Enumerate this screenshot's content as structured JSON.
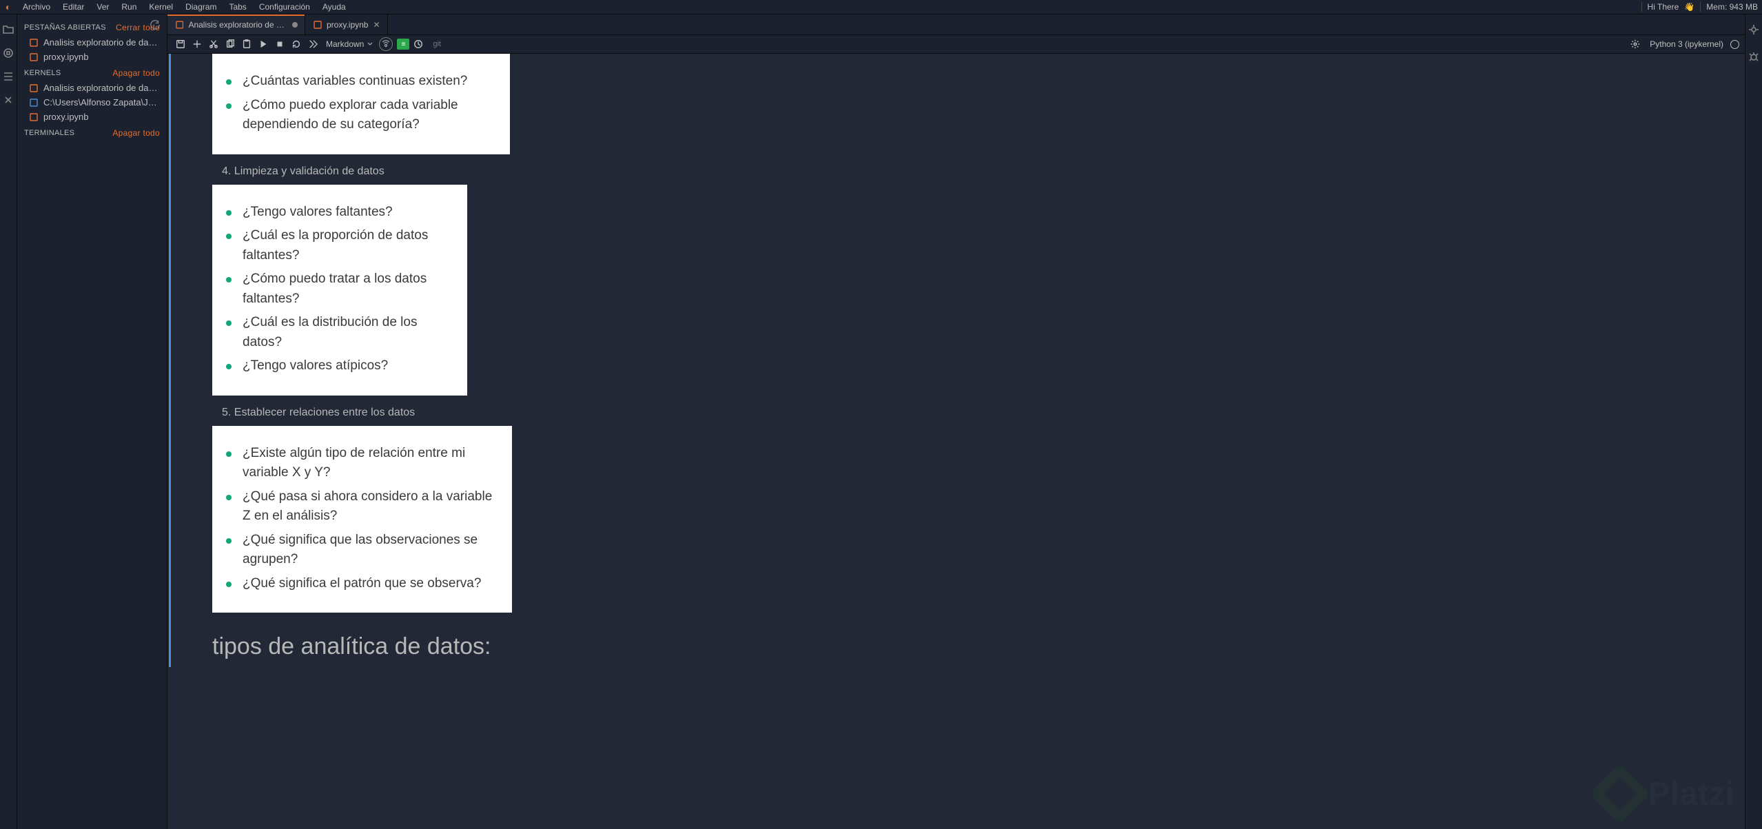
{
  "menubar": {
    "items": [
      "Archivo",
      "Editar",
      "Ver",
      "Run",
      "Kernel",
      "Diagram",
      "Tabs",
      "Configuración",
      "Ayuda"
    ],
    "hi": "Hi There",
    "mem": "Mem: 943 MB"
  },
  "sidebar": {
    "sections": [
      {
        "title": "Pestañas abiertas",
        "action": "Cerrar todo",
        "items": [
          {
            "label": "Analisis exploratorio de datos.i...",
            "icon": "nb"
          },
          {
            "label": "proxy.ipynb",
            "icon": "nb"
          }
        ]
      },
      {
        "title": "Kernels",
        "action": "Apagar todo",
        "items": [
          {
            "label": "Analisis exploratorio de datos.i...",
            "icon": "nb"
          },
          {
            "label": "C:\\Users\\Alfonso Zapata\\Jupyt...",
            "icon": "blue"
          },
          {
            "label": "proxy.ipynb",
            "icon": "nb"
          }
        ]
      },
      {
        "title": "Terminales",
        "action": "Apagar todo",
        "items": []
      }
    ]
  },
  "tabs": [
    {
      "label": "Analisis exploratorio de dato",
      "dirty": true,
      "active": true
    },
    {
      "label": "proxy.ipynb",
      "dirty": false,
      "active": false
    }
  ],
  "toolbar": {
    "celltype": "Markdown",
    "git": "git",
    "kernel": "Python 3 (ipykernel)"
  },
  "notebook": {
    "card1": {
      "items": [
        "¿Cuántas variables continuas existen?",
        "¿Cómo puedo explorar cada variable dependiendo de su categoría?"
      ]
    },
    "num4": "4. Limpieza y validación de datos",
    "card2": {
      "items": [
        "¿Tengo valores faltantes?",
        "¿Cuál es la proporción de datos faltantes?",
        "¿Cómo puedo tratar a los datos faltantes?",
        "¿Cuál es la distribución de los datos?",
        "¿Tengo valores atípicos?"
      ]
    },
    "num5": "5. Establecer relaciones entre los datos",
    "card3": {
      "items": [
        "¿Existe algún tipo de relación entre mi variable X y Y?",
        "¿Qué pasa si ahora considero a la variable Z en el análisis?",
        "¿Qué significa que las observaciones se agrupen?",
        "¿Qué significa el patrón que se observa?"
      ]
    },
    "h2": "tipos de analítica de datos:"
  },
  "watermark": "Platzi"
}
